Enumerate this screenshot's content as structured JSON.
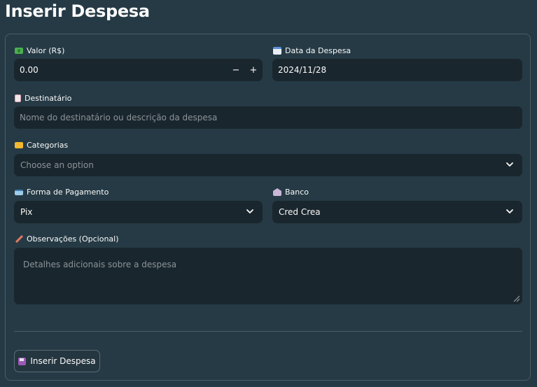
{
  "page": {
    "title": "Inserir Despesa"
  },
  "form": {
    "valor": {
      "label": "Valor (R$)",
      "value": "0.00",
      "minus": "−",
      "plus": "+"
    },
    "data": {
      "label": "Data da Despesa",
      "value": "2024/11/28"
    },
    "destinatario": {
      "label": "Destinatário",
      "placeholder": "Nome do destinatário ou descrição da despesa"
    },
    "categorias": {
      "label": "Categorias",
      "placeholder": "Choose an option"
    },
    "forma_pagamento": {
      "label": "Forma de Pagamento",
      "value": "Pix"
    },
    "banco": {
      "label": "Banco",
      "value": "Cred Crea"
    },
    "observacoes": {
      "label": "Observações (Opcional)",
      "placeholder": "Detalhes adicionais sobre a despesa"
    },
    "submit_label": "Inserir Despesa"
  },
  "icons": {
    "valor": "money-icon",
    "data": "calendar-icon",
    "destinatario": "document-icon",
    "categorias": "folder-icon",
    "forma_pagamento": "credit-card-icon",
    "banco": "bank-icon",
    "observacoes": "pencil-icon",
    "submit": "floppy-disk-icon"
  },
  "colors": {
    "background": "#253a45",
    "field": "#1a262d",
    "border": "#4a5d68",
    "text": "#fafafa",
    "placeholder": "#8a9499"
  }
}
